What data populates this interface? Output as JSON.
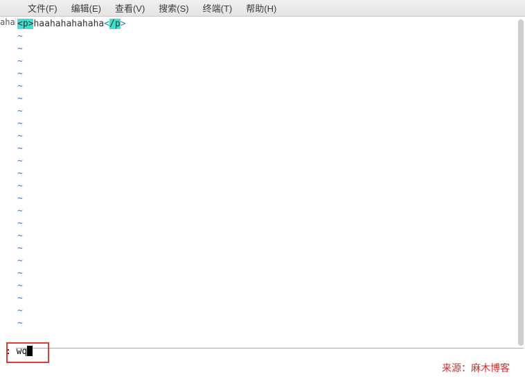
{
  "menubar": {
    "items": [
      {
        "label": "文件(F)"
      },
      {
        "label": "编辑(E)"
      },
      {
        "label": "查看(V)"
      },
      {
        "label": "搜索(S)"
      },
      {
        "label": "终端(T)"
      },
      {
        "label": "帮助(H)"
      }
    ]
  },
  "left_fragment": "ahah",
  "editor": {
    "line1": {
      "open_tag_inner": "p",
      "open_lt": "<",
      "open_gt": ">",
      "content": "haahahahahaha",
      "close_lt": "<",
      "close_slash_tag": "/p",
      "close_gt": ">"
    },
    "tilde": "~",
    "tilde_count": 24
  },
  "command": {
    "prefix": ":",
    "text": "wq"
  },
  "attribution": "来源：麻木博客"
}
